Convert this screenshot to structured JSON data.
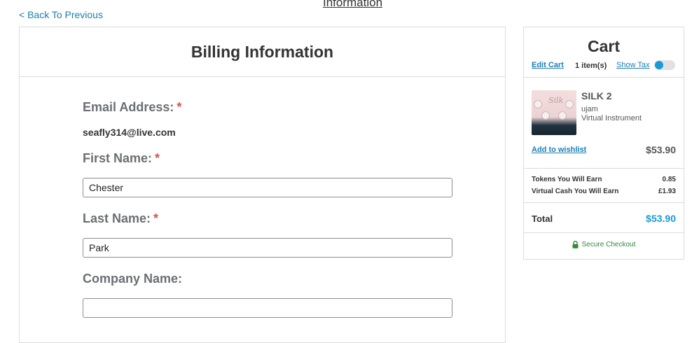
{
  "header": {
    "top_link": "Information",
    "back_link": "< Back To Previous"
  },
  "billing": {
    "title": "Billing Information",
    "email_label": "Email Address:",
    "email_value": "seafly314@live.com",
    "first_name_label": "First Name:",
    "first_name_value": "Chester",
    "last_name_label": "Last Name:",
    "last_name_value": "Park",
    "company_label": "Company Name:",
    "company_value": "",
    "required_mark": "*"
  },
  "cart": {
    "title": "Cart",
    "edit_cart": "Edit Cart",
    "items_count": "1 item(s)",
    "show_tax": "Show Tax",
    "show_tax_on": true,
    "item": {
      "name": "SILK 2",
      "brand": "ujam",
      "type": "Virtual Instrument",
      "price": "$53.90",
      "thumbnail_script": "Silk",
      "wishlist": "Add to wishlist"
    },
    "rewards": [
      {
        "label": "Tokens You Will Earn",
        "value": "0.85"
      },
      {
        "label": "Virtual Cash You Will Earn",
        "value": "£1.93"
      }
    ],
    "total_label": "Total",
    "total_value": "$53.90",
    "secure_checkout": "Secure Checkout"
  },
  "colors": {
    "link": "#1a7fb5",
    "accent": "#1a9ad9",
    "required": "#d9534f",
    "secure": "#2e8b3a"
  },
  "icons": {
    "lock": "lock-icon"
  }
}
